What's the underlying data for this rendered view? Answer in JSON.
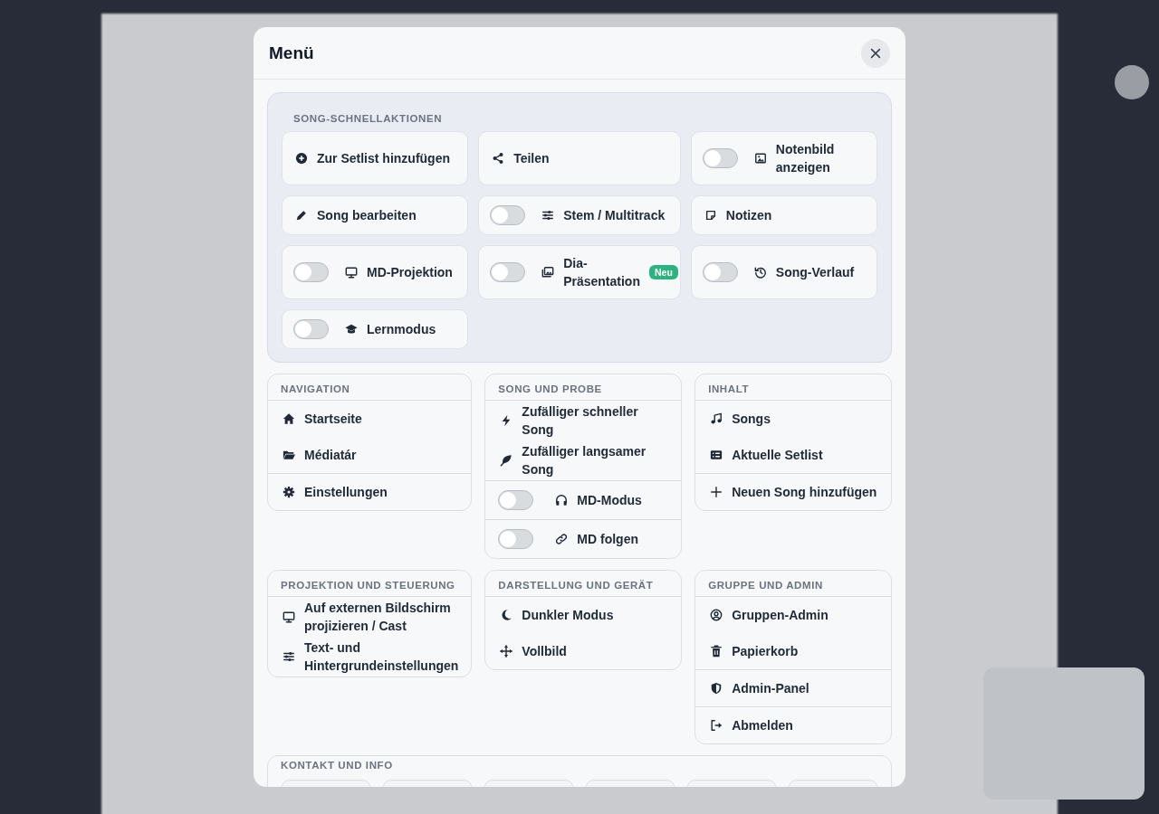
{
  "modal": {
    "title": "Menü"
  },
  "quick_actions": {
    "heading": "SONG-SCHNELLAKTIONEN",
    "items": [
      {
        "kind": "action",
        "label": "Zur Setlist hinzufügen"
      },
      {
        "kind": "action",
        "label": "Teilen"
      },
      {
        "kind": "toggle",
        "label": "Notenbild anzeigen",
        "on": false
      },
      {
        "kind": "action",
        "label": "Song bearbeiten"
      },
      {
        "kind": "toggle",
        "label": "Stem / Multitrack",
        "on": false
      },
      {
        "kind": "action",
        "label": "Notizen"
      },
      {
        "kind": "toggle",
        "label": "MD-Projektion",
        "on": false
      },
      {
        "kind": "toggle",
        "label": "Dia-Präsentation",
        "on": false,
        "badge": "Neu"
      },
      {
        "kind": "toggle",
        "label": "Song-Verlauf",
        "on": false
      },
      {
        "kind": "toggle",
        "label": "Lernmodus",
        "on": false
      }
    ]
  },
  "sections": [
    {
      "heading": "NAVIGATION",
      "items": [
        {
          "kind": "action",
          "label": "Startseite"
        },
        {
          "kind": "action",
          "label": "Médiatár"
        },
        {
          "kind": "action",
          "label": "Einstellungen"
        }
      ]
    },
    {
      "heading": "SONG UND PROBE",
      "items": [
        {
          "kind": "action",
          "label": "Zufälliger schneller Song"
        },
        {
          "kind": "action",
          "label": "Zufälliger langsamer Song"
        },
        {
          "kind": "toggle",
          "label": "MD-Modus",
          "on": false
        },
        {
          "kind": "toggle",
          "label": "MD folgen",
          "on": false
        }
      ]
    },
    {
      "heading": "INHALT",
      "items": [
        {
          "kind": "action",
          "label": "Songs"
        },
        {
          "kind": "action",
          "label": "Aktuelle Setlist"
        },
        {
          "kind": "action",
          "label": "Neuen Song hinzufügen"
        }
      ]
    },
    {
      "heading": "PROJEKTION UND STEUERUNG",
      "items": [
        {
          "kind": "action",
          "label": "Auf externen Bildschirm projizieren / Cast"
        },
        {
          "kind": "action",
          "label": "Text- und Hintergrundeinstellungen"
        }
      ]
    },
    {
      "heading": "DARSTELLUNG UND GERÄT",
      "items": [
        {
          "kind": "action",
          "label": "Dunkler Modus"
        },
        {
          "kind": "action",
          "label": "Vollbild"
        }
      ]
    },
    {
      "heading": "GRUPPE UND ADMIN",
      "items": [
        {
          "kind": "action",
          "label": "Gruppen-Admin"
        },
        {
          "kind": "action",
          "label": "Papierkorb"
        },
        {
          "kind": "action",
          "label": "Admin-Panel"
        },
        {
          "kind": "action",
          "label": "Abmelden"
        }
      ]
    }
  ],
  "contact": {
    "heading": "KONTAKT UND INFO"
  }
}
